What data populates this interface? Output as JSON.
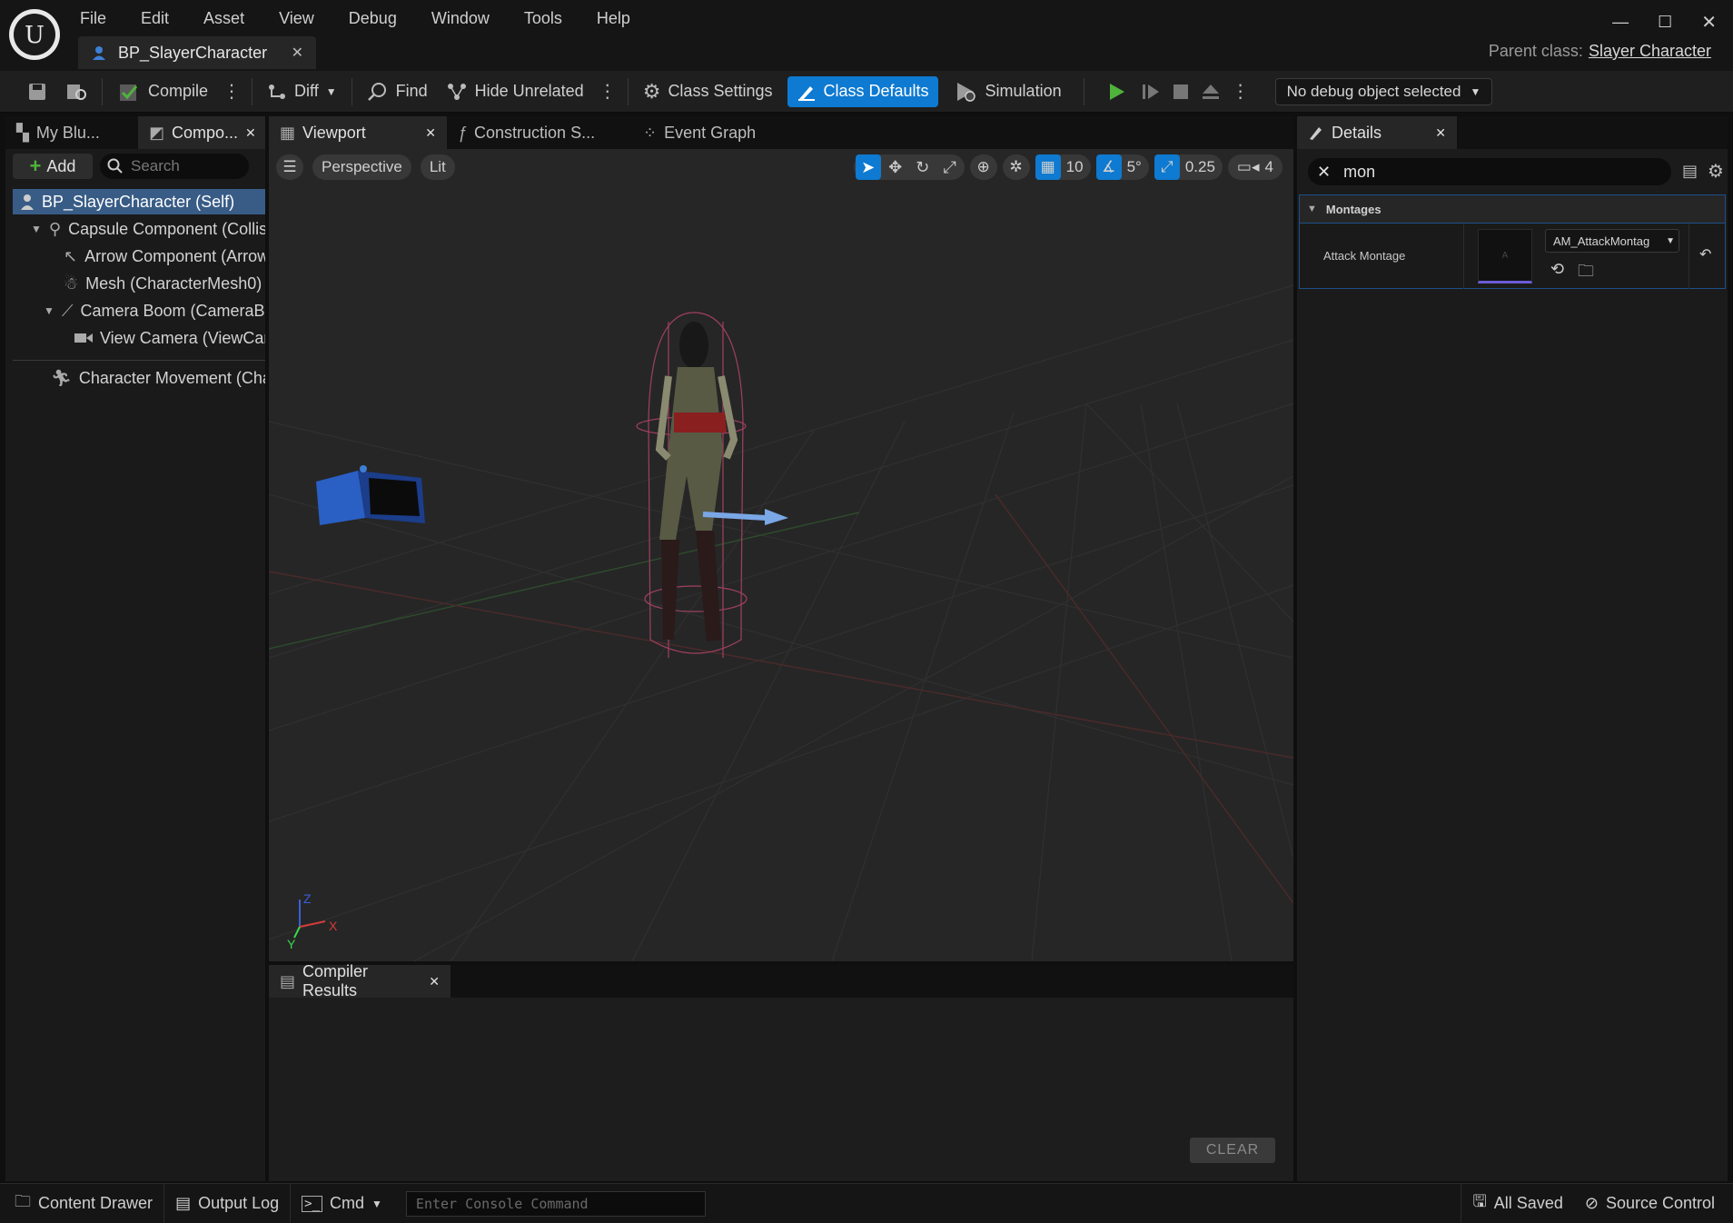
{
  "menu": [
    "File",
    "Edit",
    "Asset",
    "View",
    "Debug",
    "Window",
    "Tools",
    "Help"
  ],
  "document_tab": {
    "label": "BP_SlayerCharacter"
  },
  "parent_class": {
    "label": "Parent class:",
    "value": "Slayer Character"
  },
  "toolbar": {
    "compile": "Compile",
    "diff": "Diff",
    "find": "Find",
    "hide_unrelated": "Hide Unrelated",
    "class_settings": "Class Settings",
    "class_defaults": "Class Defaults",
    "simulation": "Simulation",
    "debug_object": "No debug object selected"
  },
  "left_panel": {
    "tabs": [
      "My Blu...",
      "Compo..."
    ],
    "add_label": "Add",
    "search_placeholder": "Search",
    "components": [
      "BP_SlayerCharacter (Self)",
      "Capsule Component (Collis",
      "Arrow Component (Arrow",
      "Mesh (CharacterMesh0)",
      "Camera Boom (CameraBo",
      "View Camera (ViewCam",
      "Character Movement (Char"
    ]
  },
  "editor_tabs": [
    "Viewport",
    "Construction S...",
    "Event Graph"
  ],
  "viewport": {
    "perspective": "Perspective",
    "lit": "Lit",
    "grid_snap": "10",
    "rotation_snap": "5°",
    "scale_snap": "0.25",
    "camera_speed": "4",
    "axis_x": "X",
    "axis_y": "Y",
    "axis_z": "Z"
  },
  "compiler": {
    "tab": "Compiler Results",
    "clear": "CLEAR"
  },
  "details": {
    "tab": "Details",
    "search_value": "mon",
    "category": "Montages",
    "property": "Attack Montage",
    "asset_value": "AM_AttackMontag"
  },
  "status_bar": {
    "content_drawer": "Content Drawer",
    "output_log": "Output Log",
    "cmd": "Cmd",
    "console_placeholder": "Enter Console Command",
    "all_saved": "All Saved",
    "source_control": "Source Control"
  },
  "colors": {
    "accent": "#0e7ad1",
    "selection": "#385c86",
    "play": "#4fb33b"
  }
}
